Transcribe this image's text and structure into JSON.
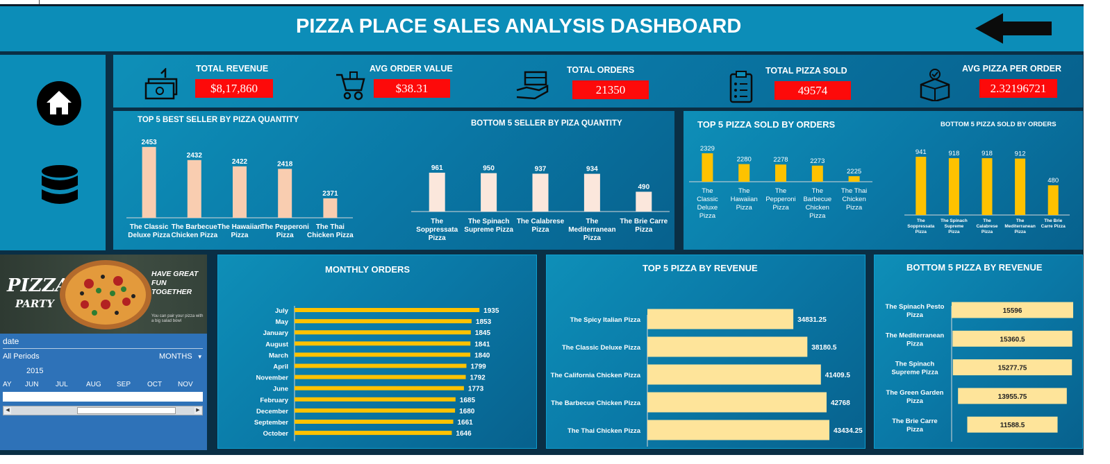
{
  "title": "PIZZA PLACE SALES ANALYSIS DASHBOARD",
  "colors": {
    "header_bg": "#0c8db8",
    "kpi_value_bg": "#fd0a0a",
    "bar_peach": "#f9cdb0",
    "bar_cream": "#fbe7dc",
    "bar_gold": "#fec200",
    "bar_light_gold": "#fee49a",
    "slicer_bg": "#2e72b8"
  },
  "nav": {
    "back_icon": "left-arrow-icon",
    "home_icon": "home-icon",
    "data_icon": "database-icon"
  },
  "kpis": [
    {
      "label": "TOTAL REVENUE",
      "value": "$8,17,860",
      "icon": "money-icon"
    },
    {
      "label": "AVG ORDER VALUE",
      "value": "$38.31",
      "icon": "cart-icon"
    },
    {
      "label": "TOTAL ORDERS",
      "value": "21350",
      "icon": "box-hand-icon"
    },
    {
      "label": "TOTAL PIZZA SOLD",
      "value": "49574",
      "icon": "clipboard-icon"
    },
    {
      "label": "AVG PIZZA PER ORDER",
      "value": "2.32196721",
      "icon": "box-check-icon"
    }
  ],
  "promo": {
    "title": "PIZZA",
    "subtitle": "PARTY",
    "tagline": "HAVE GREAT FUN TOGETHER",
    "small": "You can pair your pizza with a big salad bowl"
  },
  "slicer": {
    "header": "date",
    "periods": "All Periods",
    "level": "MONTHS",
    "year": "2015",
    "months": [
      "AY",
      "JUN",
      "JUL",
      "AUG",
      "SEP",
      "OCT",
      "NOV"
    ]
  },
  "chart_data": [
    {
      "type": "bar",
      "title": "TOP 5  BEST SELLER BY PIZZA QUANTITY",
      "categories": [
        "The Classic Deluxe Pizza",
        "The Barbecue Chicken Pizza",
        "The Hawaiian Pizza",
        "The Pepperoni Pizza",
        "The Thai Chicken Pizza"
      ],
      "values": [
        2453,
        2432,
        2422,
        2418,
        2371
      ],
      "ylim": [
        2340,
        2455
      ]
    },
    {
      "type": "bar",
      "title": "BOTTOM 5 SELLER BY PIZA QUANTITY",
      "categories": [
        "The Soppressata Pizza",
        "The Spinach Supreme Pizza",
        "The Calabrese Pizza",
        "The Mediterranean Pizza",
        "The Brie Carre Pizza"
      ],
      "values": [
        961,
        950,
        937,
        934,
        490
      ],
      "ylim": [
        0,
        961
      ]
    },
    {
      "type": "bar",
      "title": "TOP 5 PIZZA SOLD BY ORDERS",
      "categories": [
        "The Classic Deluxe Pizza",
        "The Hawaiian Pizza",
        "The Pepperoni Pizza",
        "The Barbecue Chicken Pizza",
        "The Thai Chicken Pizza"
      ],
      "values": [
        2329,
        2280,
        2278,
        2273,
        2225
      ],
      "ylim": [
        2200,
        2329
      ]
    },
    {
      "type": "bar",
      "title": "BOTTOM 5 PIZZA SOLD BY ORDERS",
      "categories": [
        "The Soppressata Pizza",
        "The Spinach Supreme Pizza",
        "The Calabrese Pizza",
        "The Mediterranean Pizza",
        "The Brie Carre Pizza"
      ],
      "values": [
        941,
        918,
        918,
        912,
        480
      ],
      "ylim": [
        0,
        941
      ]
    },
    {
      "type": "bar",
      "orientation": "horizontal",
      "title": "MONTHLY ORDERS",
      "categories": [
        "July",
        "May",
        "January",
        "August",
        "March",
        "April",
        "November",
        "June",
        "February",
        "December",
        "September",
        "October"
      ],
      "values": [
        1935,
        1853,
        1845,
        1841,
        1840,
        1799,
        1792,
        1773,
        1685,
        1680,
        1661,
        1646
      ],
      "xlim": [
        0,
        2050
      ]
    },
    {
      "type": "bar",
      "orientation": "horizontal",
      "title": "TOP 5 PIZZA BY REVENUE",
      "categories": [
        "The Spicy Italian Pizza",
        "The Classic Deluxe Pizza",
        "The California Chicken Pizza",
        "The Barbecue Chicken Pizza",
        "The Thai Chicken Pizza"
      ],
      "values": [
        34831.25,
        38180.5,
        41409.5,
        42768,
        43434.25
      ],
      "labels": [
        "34831.25",
        "38180.5",
        "41409.5",
        "42768",
        "43434.25"
      ],
      "xlim": [
        0,
        43434.25
      ]
    },
    {
      "type": "bar",
      "orientation": "horizontal",
      "title": "BOTTOM 5 PIZZA BY REVENUE",
      "categories": [
        "The Spinach Pesto Pizza",
        "The Mediterranean Pizza",
        "The Spinach Supreme Pizza",
        "The Green Garden Pizza",
        "The Brie Carre Pizza"
      ],
      "values": [
        15596,
        15360.5,
        15277.75,
        13955.75,
        11588.5
      ],
      "labels": [
        "15596",
        "15360.5",
        "15277.75",
        "13955.75",
        "11588.5"
      ],
      "xlim": [
        0,
        15596
      ]
    }
  ]
}
